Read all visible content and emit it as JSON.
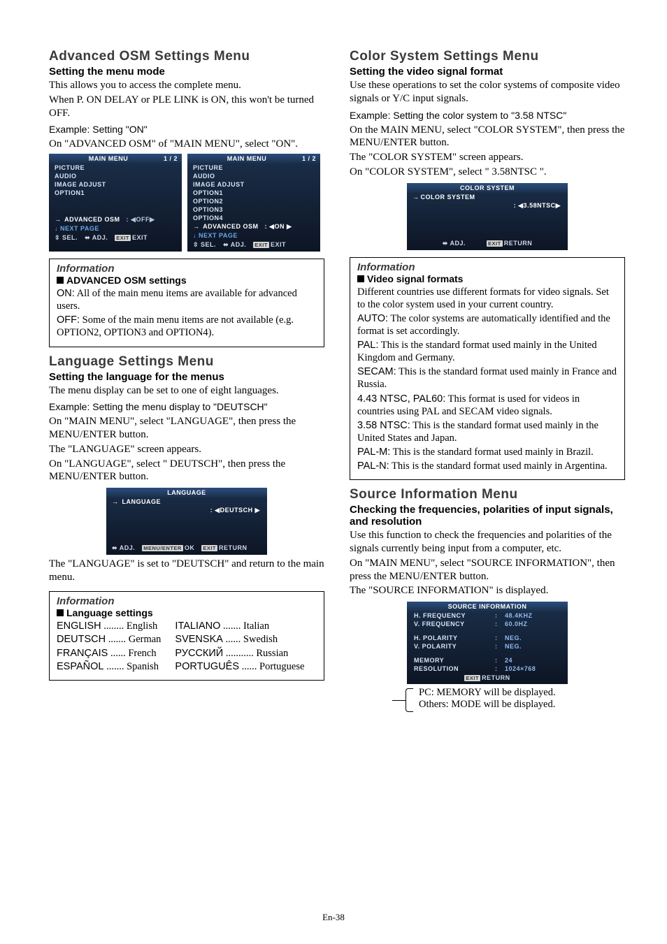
{
  "page_number": "En-38",
  "left": {
    "sec1": {
      "title": "Advanced OSM Settings Menu",
      "subtitle": "Setting the menu mode",
      "p1": "This allows you to access the complete menu.",
      "p2": "When P. ON DELAY or PLE LINK is ON, this won't be turned OFF.",
      "example": "Example: Setting \"ON\"",
      "p3": "On \"ADVANCED OSM\" of \"MAIN MENU\", select \"ON\"."
    },
    "osd_off": {
      "title": "MAIN MENU",
      "pg": "1 / 2",
      "items": [
        "PICTURE",
        "AUDIO",
        "IMAGE ADJUST",
        "OPTION1"
      ],
      "adv_label": "ADVANCED OSM",
      "adv_value": ": ◀OFF▶",
      "next": "↓ NEXT PAGE",
      "sel": "SEL.",
      "adj": "ADJ.",
      "exit_key": "EXIT",
      "exit": "EXIT"
    },
    "osd_on": {
      "title": "MAIN MENU",
      "pg": "1 / 2",
      "items": [
        "PICTURE",
        "AUDIO",
        "IMAGE ADJUST",
        "OPTION1",
        "OPTION2",
        "OPTION3",
        "OPTION4"
      ],
      "adv_label": "ADVANCED OSM",
      "adv_value": ": ◀ON ▶",
      "next": "↓ NEXT PAGE",
      "sel": "SEL.",
      "adj": "ADJ.",
      "exit_key": "EXIT",
      "exit": "EXIT"
    },
    "info1": {
      "title": "Information",
      "sub": "ADVANCED OSM settings",
      "on_label": "ON:",
      "on_text": " All of the main menu items are available for advanced users.",
      "off_label": "OFF:",
      "off_text": " Some of the main menu items are not available (e.g. OPTION2, OPTION3 and OPTION4)."
    },
    "sec2": {
      "title": "Language Settings Menu",
      "subtitle": "Setting the language for the menus",
      "p1": "The menu display can be set to one of eight languages.",
      "example": "Example: Setting the menu display to \"DEUTSCH\"",
      "p2": "On \"MAIN MENU\", select \"LANGUAGE\", then press the MENU/ENTER button.",
      "p3": "The \"LANGUAGE\" screen appears.",
      "p4": "On \"LANGUAGE\", select \" DEUTSCH\", then press the MENU/ENTER button."
    },
    "osd_lang": {
      "title": "LANGUAGE",
      "label": "LANGUAGE",
      "value": ": ◀DEUTSCH ▶",
      "adj": "ADJ.",
      "ok_key": "MENU/ENTER",
      "ok": "OK",
      "exit_key": "EXIT",
      "ret": "RETURN"
    },
    "p_after_lang": "The \"LANGUAGE\" is set to \"DEUTSCH\" and return to the main menu.",
    "info2": {
      "title": "Information",
      "sub": "Language settings",
      "left": [
        {
          "label": "ENGLISH",
          "dots": " ........ ",
          "name": "English"
        },
        {
          "label": "DEUTSCH",
          "dots": " ....... ",
          "name": "German"
        },
        {
          "label": "FRANÇAIS",
          "dots": " ...... ",
          "name": "French"
        },
        {
          "label": "ESPAÑOL",
          "dots": " ....... ",
          "name": "Spanish"
        }
      ],
      "right": [
        {
          "label": "ITALIANO",
          "dots": " ....... ",
          "name": "Italian"
        },
        {
          "label": "SVENSKA",
          "dots": " ...... ",
          "name": "Swedish"
        },
        {
          "label": "РУССКИЙ",
          "dots": " ........... ",
          "name": "Russian"
        },
        {
          "label": "PORTUGUÊS",
          "dots": " ...... ",
          "name": "Portuguese"
        }
      ]
    }
  },
  "right": {
    "sec1": {
      "title": "Color System Settings Menu",
      "subtitle": "Setting the video signal format",
      "p1": "Use these operations to set the color systems of composite video signals or Y/C input signals.",
      "example": "Example: Setting the color system to \"3.58 NTSC\"",
      "p2": "On the MAIN MENU, select \"COLOR SYSTEM\", then press the MENU/ENTER button.",
      "p3": "The \"COLOR SYSTEM\" screen appears.",
      "p4": "On \"COLOR SYSTEM\", select \" 3.58NTSC \"."
    },
    "osd_color": {
      "title": "COLOR SYSTEM",
      "label": "COLOR SYSTEM",
      "value": ": ◀3.58NTSC▶",
      "adj": "ADJ.",
      "exit_key": "EXIT",
      "ret": "RETURN"
    },
    "info1": {
      "title": "Information",
      "sub": "Video signal formats",
      "p0": "Different countries use different formats for video signals. Set to the color system used in your current country.",
      "items": [
        {
          "label": "AUTO:",
          "text": " The color systems are automatically identified and the format is set accordingly."
        },
        {
          "label": "PAL:",
          "text": " This is the standard format used mainly in the United Kingdom and Germany."
        },
        {
          "label": "SECAM:",
          "text": " This is the standard format used mainly in France and Russia."
        },
        {
          "label": "4.43 NTSC, PAL60:",
          "text": " This format is used for videos in countries using PAL and SECAM video signals."
        },
        {
          "label": "3.58 NTSC:",
          "text": " This is the standard format used mainly in the United States and Japan."
        },
        {
          "label": "PAL-M:",
          "text": " This is the standard format used mainly in Brazil."
        },
        {
          "label": "PAL-N:",
          "text": " This is the standard format used mainly in Argentina."
        }
      ]
    },
    "sec2": {
      "title": "Source Information Menu",
      "subtitle": "Checking the frequencies, polarities of input signals, and resolution",
      "p1": "Use this function to check the frequencies and polarities of the signals currently being input from a computer, etc.",
      "p2": "On \"MAIN MENU\", select \"SOURCE INFORMATION\", then press the MENU/ENTER button.",
      "p3": "The \"SOURCE INFORMATION\" is displayed."
    },
    "osd_source": {
      "title": "SOURCE INFORMATION",
      "rows": [
        {
          "k": "H. FREQUENCY",
          "v": "48.4KHZ"
        },
        {
          "k": "V. FREQUENCY",
          "v": "60.0HZ"
        },
        {
          "sp": true
        },
        {
          "k": "H. POLARITY",
          "v": "NEG."
        },
        {
          "k": "V. POLARITY",
          "v": "NEG."
        },
        {
          "sp": true
        },
        {
          "k": "MEMORY",
          "v": "24"
        },
        {
          "k": "RESOLUTION",
          "v": "1024×768"
        }
      ],
      "exit_key": "EXIT",
      "ret": "RETURN"
    },
    "callout": {
      "l1": "PC:       MEMORY will be displayed.",
      "l2": "Others: MODE will be displayed."
    }
  }
}
